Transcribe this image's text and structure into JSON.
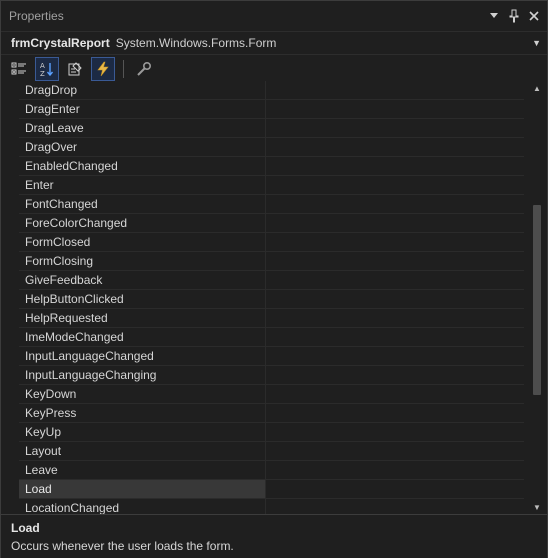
{
  "window": {
    "title": "Properties"
  },
  "object_selector": {
    "name": "frmCrystalReport",
    "type": "System.Windows.Forms.Form"
  },
  "toolbar": {
    "buttons": [
      {
        "icon": "categorized-icon",
        "active": false
      },
      {
        "icon": "alphabetical-icon",
        "active": true
      },
      {
        "icon": "properties-icon",
        "active": false
      },
      {
        "icon": "events-icon",
        "active": true
      },
      {
        "icon": "property-pages-icon",
        "active": false
      }
    ]
  },
  "events": [
    {
      "name": "DragDrop",
      "value": ""
    },
    {
      "name": "DragEnter",
      "value": ""
    },
    {
      "name": "DragLeave",
      "value": ""
    },
    {
      "name": "DragOver",
      "value": ""
    },
    {
      "name": "EnabledChanged",
      "value": ""
    },
    {
      "name": "Enter",
      "value": ""
    },
    {
      "name": "FontChanged",
      "value": ""
    },
    {
      "name": "ForeColorChanged",
      "value": ""
    },
    {
      "name": "FormClosed",
      "value": ""
    },
    {
      "name": "FormClosing",
      "value": ""
    },
    {
      "name": "GiveFeedback",
      "value": ""
    },
    {
      "name": "HelpButtonClicked",
      "value": ""
    },
    {
      "name": "HelpRequested",
      "value": ""
    },
    {
      "name": "ImeModeChanged",
      "value": ""
    },
    {
      "name": "InputLanguageChanged",
      "value": ""
    },
    {
      "name": "InputLanguageChanging",
      "value": ""
    },
    {
      "name": "KeyDown",
      "value": ""
    },
    {
      "name": "KeyPress",
      "value": ""
    },
    {
      "name": "KeyUp",
      "value": ""
    },
    {
      "name": "Layout",
      "value": ""
    },
    {
      "name": "Leave",
      "value": ""
    },
    {
      "name": "Load",
      "value": "",
      "selected": true
    },
    {
      "name": "LocationChanged",
      "value": ""
    }
  ],
  "description": {
    "title": "Load",
    "text": "Occurs whenever the user loads the form."
  },
  "colors": {
    "accent": "#3a5a95",
    "background": "#1f1f1f",
    "selected_row": "#383838"
  }
}
